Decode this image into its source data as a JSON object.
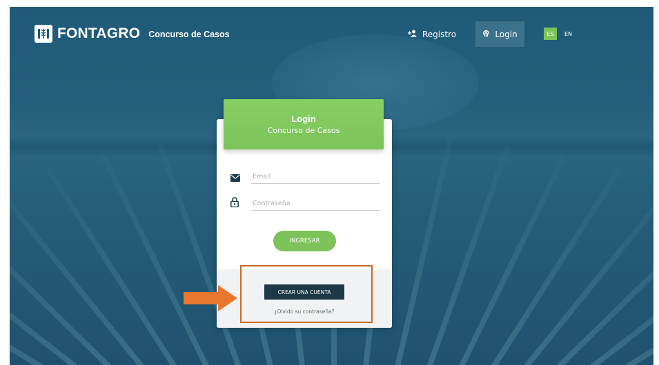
{
  "header": {
    "brand": "FONTAGRO",
    "brand_sub": "Concurso de Casos",
    "nav": {
      "registro": "Registro",
      "login": "Login"
    },
    "languages": {
      "active": "ES",
      "other": "EN"
    }
  },
  "login_card": {
    "title": "Login",
    "subtitle": "Concurso de Casos",
    "email_placeholder": "Email",
    "password_placeholder": "Contraseña",
    "submit_label": "INGRESAR",
    "create_account_label": "CREAR UNA CUENTA",
    "forgot_password": "¿Olvido su contraseña?"
  },
  "colors": {
    "accent_green": "#7cc35a",
    "background_blue": "#245f7c",
    "dark_button": "#1c3947",
    "annotation_orange": "#e8772e"
  },
  "icons": {
    "logo": "fontagro-logo-icon",
    "registro": "add-user-icon",
    "login": "fingerprint-icon",
    "email": "envelope-icon",
    "password": "padlock-icon",
    "annotation": "arrow-right-icon"
  }
}
